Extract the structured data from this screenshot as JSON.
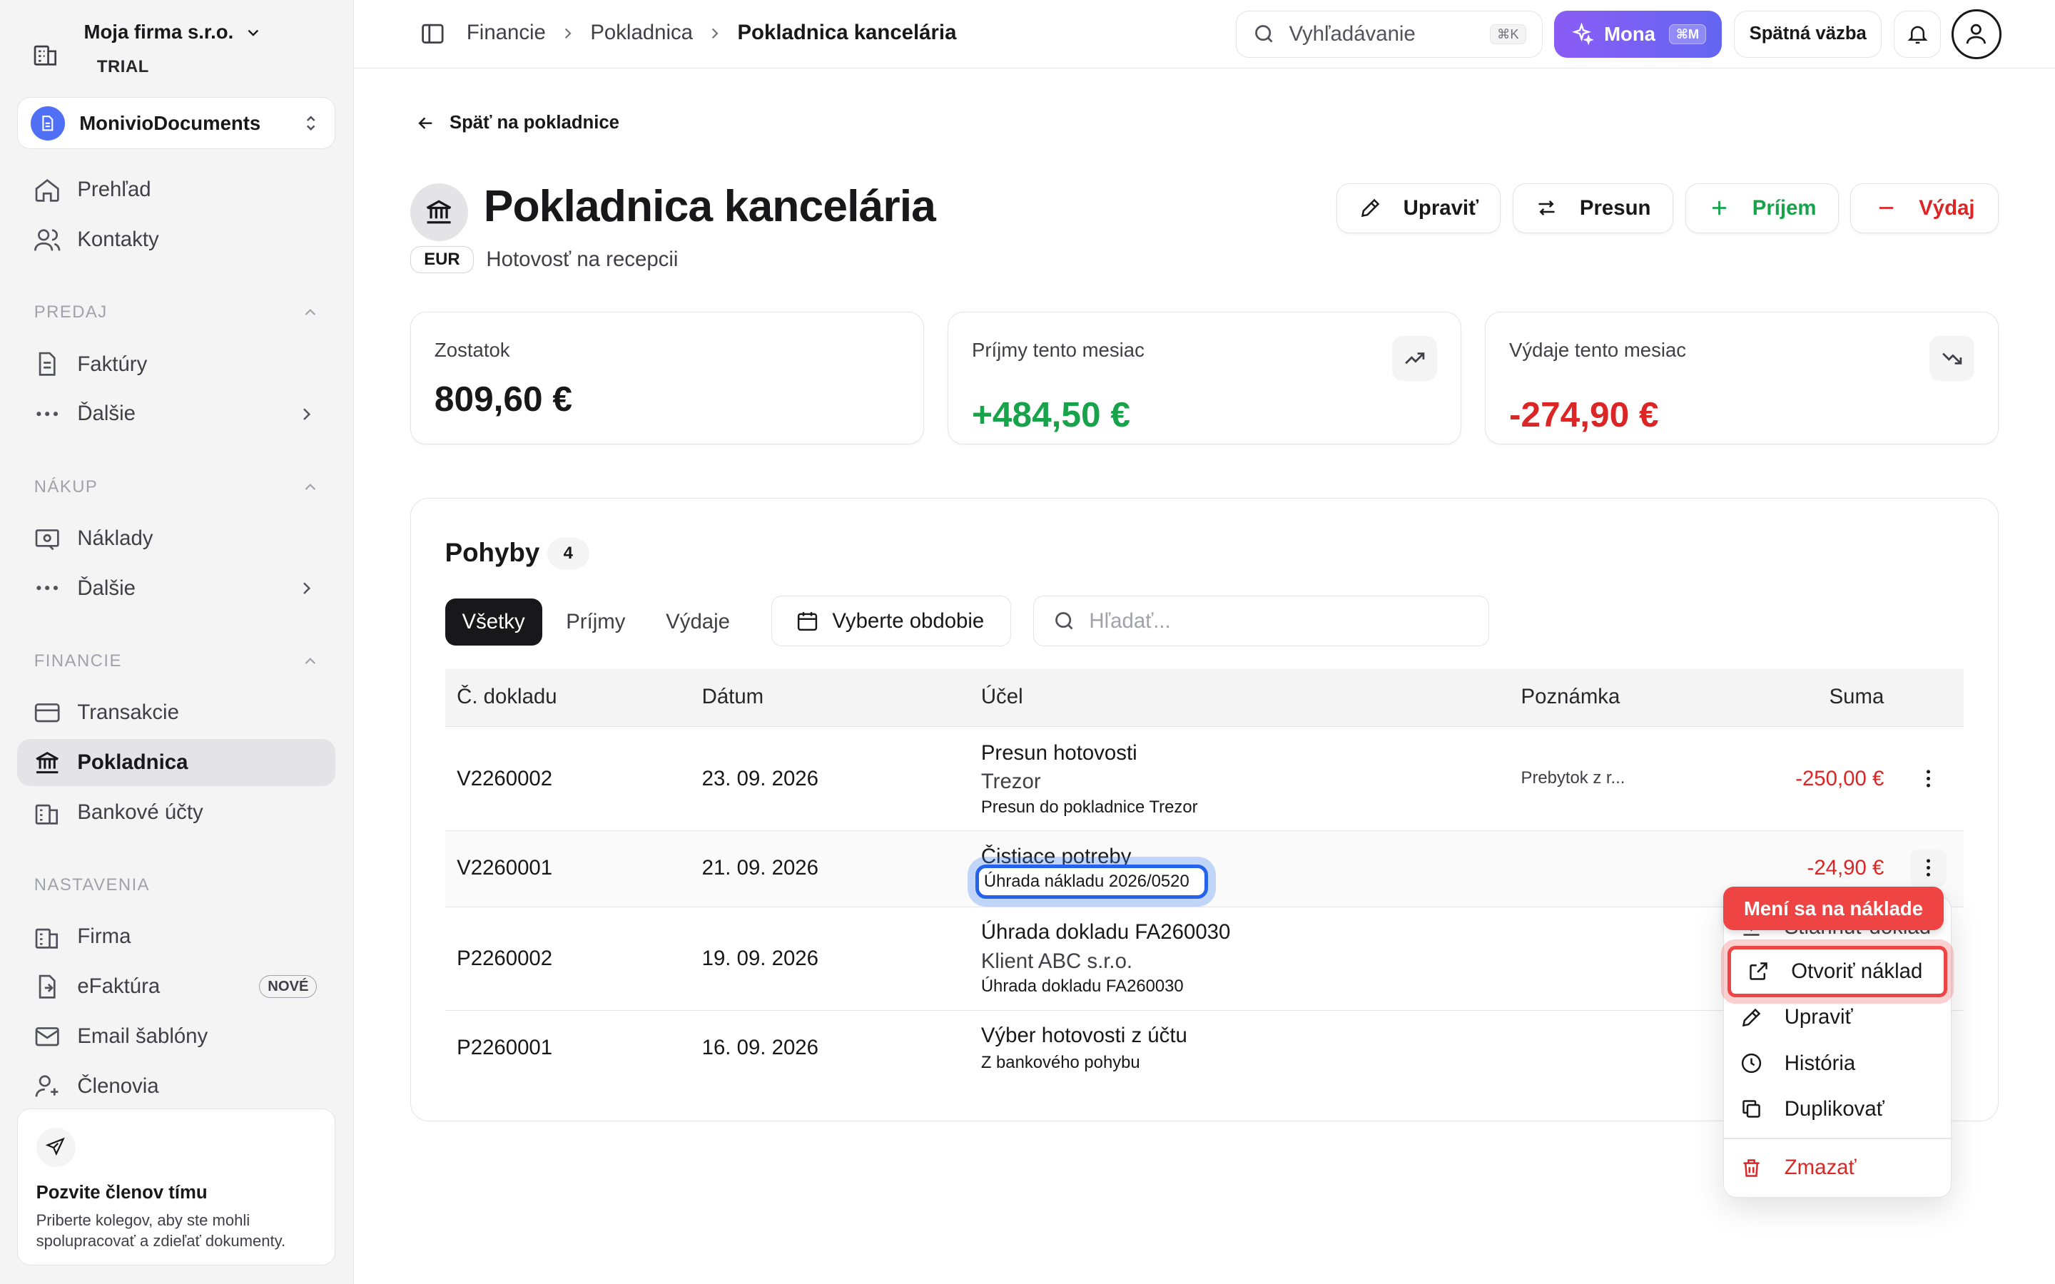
{
  "org": {
    "name": "Moja firma s.r.o.",
    "plan": "TRIAL"
  },
  "workspace": {
    "name": "MonivioDocuments"
  },
  "sidebar": {
    "top": [
      {
        "label": "Prehľad"
      },
      {
        "label": "Kontakty"
      }
    ],
    "predaj": {
      "title": "PREDAJ",
      "items": [
        {
          "label": "Faktúry"
        },
        {
          "label": "Ďalšie"
        }
      ]
    },
    "nakup": {
      "title": "NÁKUP",
      "items": [
        {
          "label": "Náklady"
        },
        {
          "label": "Ďalšie"
        }
      ]
    },
    "financie": {
      "title": "FINANCIE",
      "items": [
        {
          "label": "Transakcie"
        },
        {
          "label": "Pokladnica"
        },
        {
          "label": "Bankové účty"
        }
      ]
    },
    "nastavenia": {
      "title": "NASTAVENIA",
      "items": [
        {
          "label": "Firma"
        },
        {
          "label": "eFaktúra",
          "badge": "NOVÉ"
        },
        {
          "label": "Email šablóny"
        },
        {
          "label": "Členovia"
        }
      ]
    },
    "invite": {
      "title": "Pozvite členov tímu",
      "text": "Priberte kolegov, aby ste mohli spolupracovať a zdieľať dokumenty."
    }
  },
  "topbar": {
    "breadcrumbs": [
      "Financie",
      "Pokladnica",
      "Pokladnica kancelária"
    ],
    "search_placeholder": "Vyhľadávanie",
    "search_kbd": "⌘K",
    "mona_label": "Mona",
    "mona_kbd": "⌘M",
    "feedback_label": "Spätná väzba"
  },
  "page": {
    "back_label": "Späť na pokladnice",
    "title": "Pokladnica kancelária",
    "currency": "EUR",
    "subtitle": "Hotovosť na recepcii",
    "actions": {
      "edit": "Upraviť",
      "transfer": "Presun",
      "income": "Príjem",
      "expense": "Výdaj"
    }
  },
  "stats": {
    "balance": {
      "label": "Zostatok",
      "value": "809,60 €"
    },
    "income": {
      "label": "Príjmy tento mesiac",
      "value": "+484,50 €"
    },
    "expense": {
      "label": "Výdaje tento mesiac",
      "value": "-274,90 €"
    }
  },
  "movements": {
    "title": "Pohyby",
    "count": "4",
    "tabs": [
      "Všetky",
      "Príjmy",
      "Výdaje"
    ],
    "period_placeholder": "Vyberte obdobie",
    "search_placeholder": "Hľadať...",
    "columns": [
      "Č. dokladu",
      "Dátum",
      "Účel",
      "Poznámka",
      "Suma"
    ],
    "rows": [
      {
        "doc": "V2260002",
        "date": "23. 09. 2026",
        "purpose": "Presun hotovosti",
        "party": "Trezor",
        "desc": "Presun do pokladnice Trezor",
        "note": "Prebytok z r...",
        "amount": "-250,00 €"
      },
      {
        "doc": "V2260001",
        "date": "21. 09. 2026",
        "purpose": "Čistiace potreby",
        "party": "",
        "desc": "Úhrada nákladu 2026/0520",
        "note": "",
        "amount": "-24,90 €"
      },
      {
        "doc": "P2260002",
        "date": "19. 09. 2026",
        "purpose": "Úhrada dokladu FA260030",
        "party": "Klient ABC s.r.o.",
        "desc": "Úhrada dokladu FA260030",
        "note": "",
        "amount": ""
      },
      {
        "doc": "P2260001",
        "date": "16. 09. 2026",
        "purpose": "Výber hotovosti z účtu",
        "party": "",
        "desc": "Z bankového pohybu",
        "note": "",
        "amount": ""
      }
    ]
  },
  "context_menu": {
    "tooltip": "Mení sa na náklade",
    "items": [
      "Stiahnuť doklad",
      "Otvoriť náklad",
      "Upraviť",
      "História",
      "Duplikovať",
      "Zmazať"
    ]
  }
}
